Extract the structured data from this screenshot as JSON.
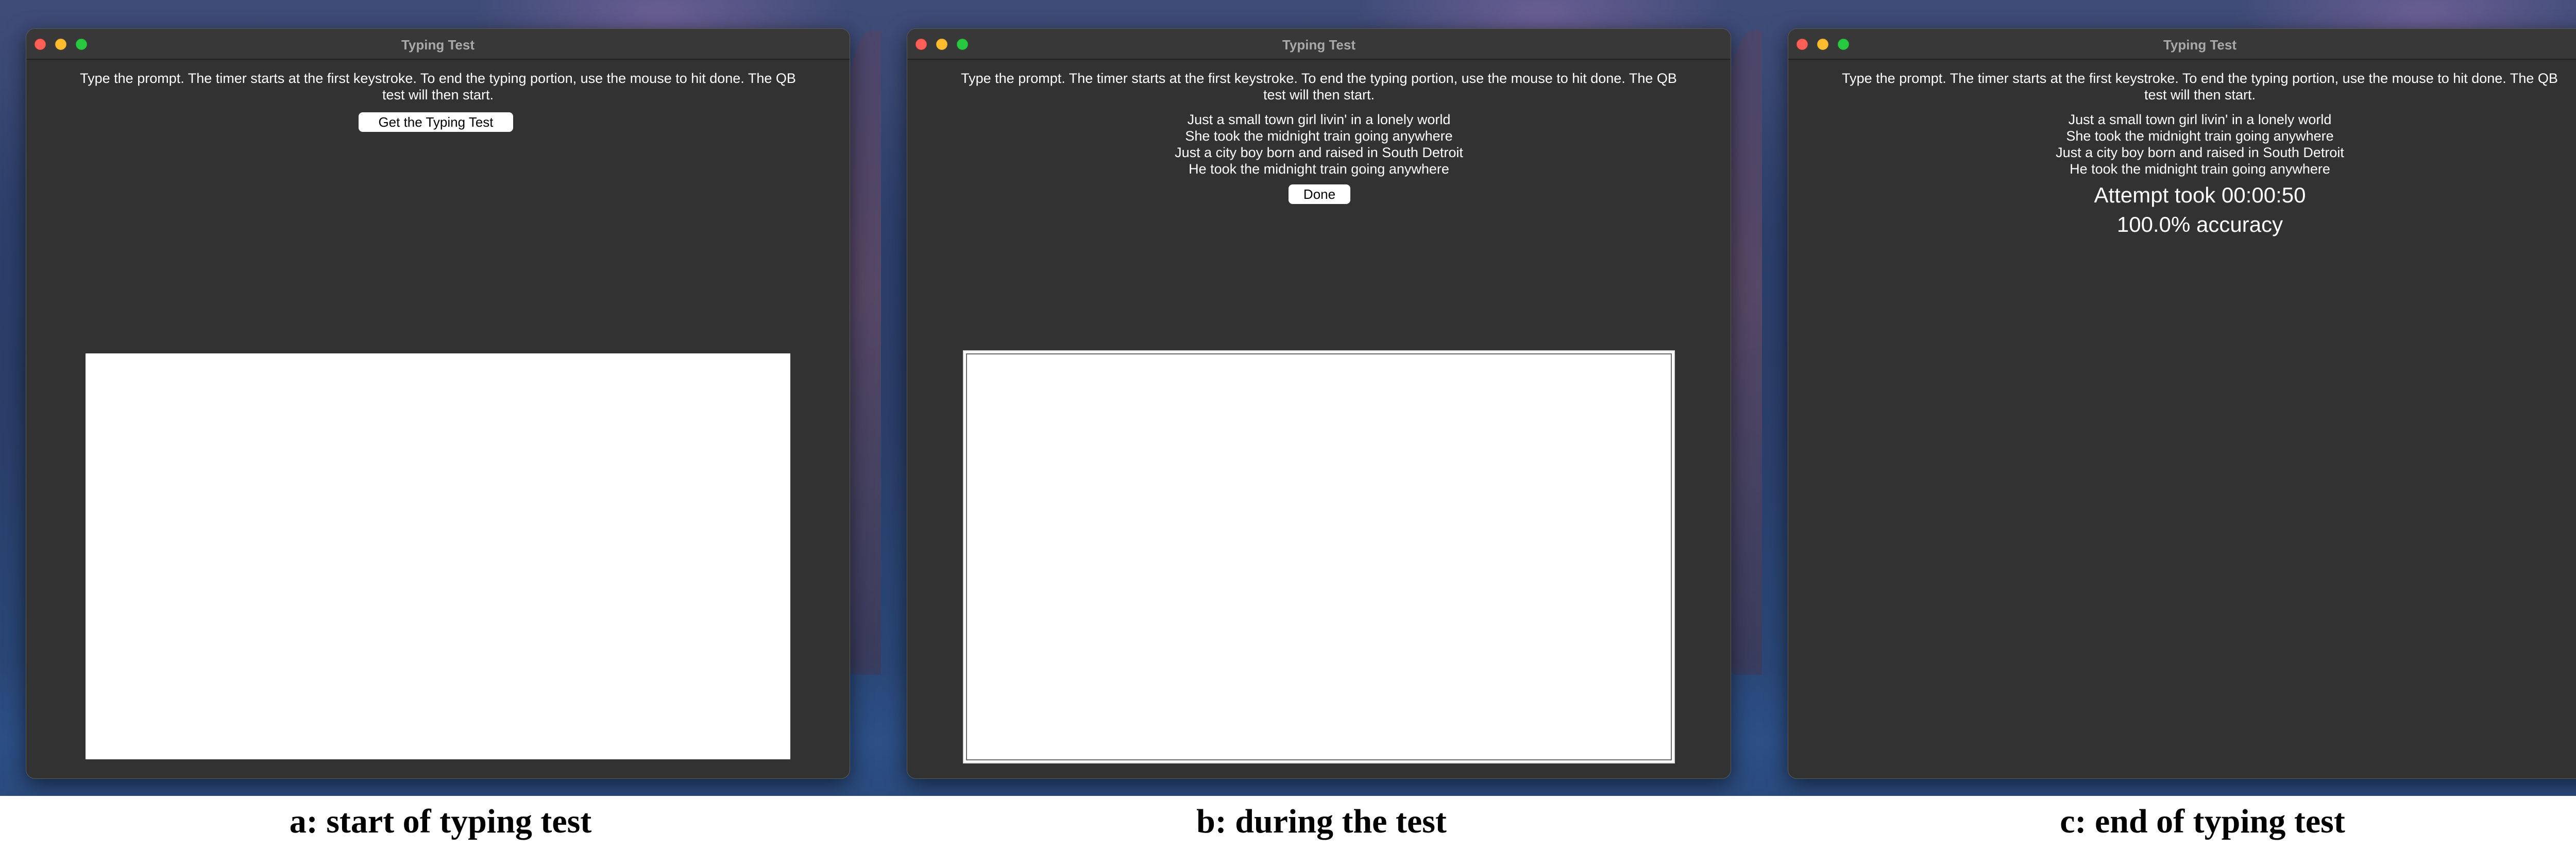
{
  "panels": [
    {
      "window_title": "Typing Test",
      "instructions": "Type the prompt. The timer starts at the first keystroke. To end the typing portion, use the mouse to hit done. The QB test will then start.",
      "get_button_label": "Get the Typing Test",
      "caption": "a: start of typing test"
    },
    {
      "window_title": "Typing Test",
      "instructions": "Type the prompt. The timer starts at the first keystroke. To end the typing portion, use the mouse to hit done. The QB test will then start.",
      "prompt_lines": [
        "Just a small town girl livin' in a lonely world",
        "She took the midnight train going anywhere",
        "Just a city boy born and raised in South Detroit",
        "He took the midnight train going anywhere"
      ],
      "done_button_label": "Done",
      "caption": "b: during the test"
    },
    {
      "window_title": "Typing Test",
      "instructions": "Type the prompt. The timer starts at the first keystroke. To end the typing portion, use the mouse to hit done. The QB test will then start.",
      "prompt_lines": [
        "Just a small town girl livin' in a lonely world",
        "She took the midnight train going anywhere",
        "Just a city boy born and raised in South Detroit",
        "He took the midnight train going anywhere"
      ],
      "attempt_text": "Attempt took 00:00:50",
      "accuracy_text": "100.0% accuracy",
      "caption": "c: end of typing test"
    }
  ],
  "colors": {
    "window_bg": "#323232",
    "titlebar_bg": "#383838",
    "close": "#fe5f57",
    "minimize": "#febc2e",
    "maximize": "#28c840"
  },
  "icons": [
    "close-window-icon",
    "minimize-window-icon",
    "maximize-window-icon"
  ]
}
